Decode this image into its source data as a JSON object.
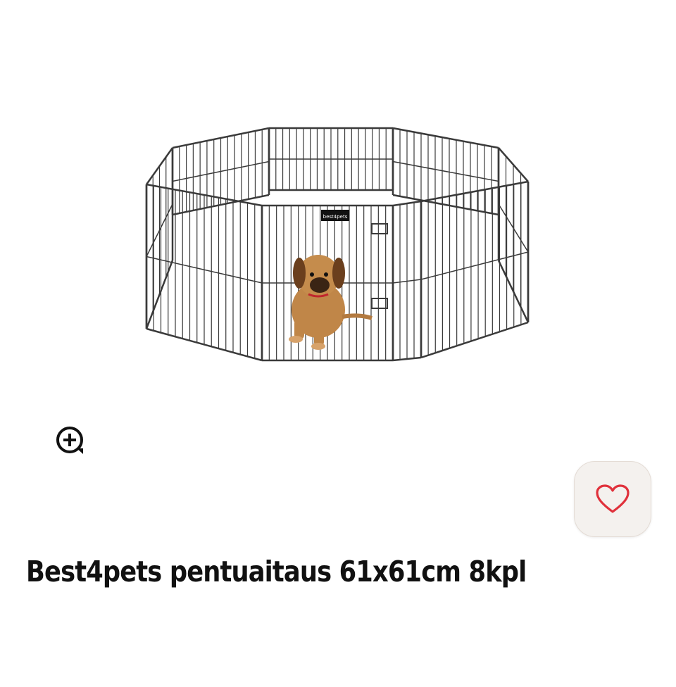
{
  "product": {
    "title": "Best4pets pentuaitaus 61x61cm 8kpl",
    "image_label": "best4pets"
  },
  "icons": {
    "zoom": "zoom-in-icon",
    "favorite": "heart-outline-icon"
  },
  "colors": {
    "heart": "#e0313b",
    "fav_background": "#f4f1ee",
    "title": "#111111",
    "wire": "#333333"
  }
}
